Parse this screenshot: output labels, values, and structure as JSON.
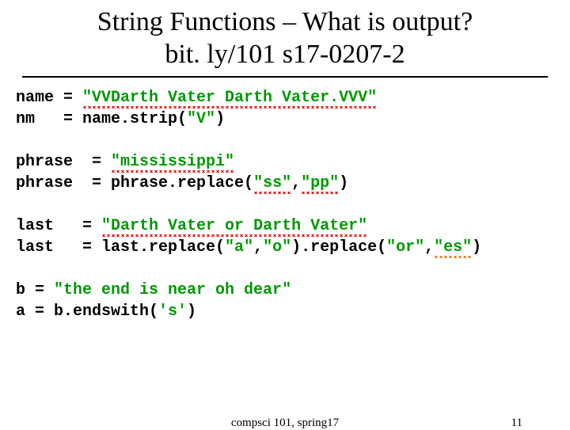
{
  "title": {
    "line1": "String Functions – What is output?",
    "line2": "bit. ly/101 s17-0207-2"
  },
  "code": {
    "l1a": "name = ",
    "l1b": "\"VVDarth Vater Darth Vater.VVV\"",
    "l2a": "nm   = name.strip(",
    "l2b": "\"V\"",
    "l2c": ")",
    "l3a": "phrase  = ",
    "l3b": "\"mississippi\"",
    "l4a": "phrase  = phrase.replace(",
    "l4b": "\"ss\"",
    "l4c": ",",
    "l4d": "\"pp\"",
    "l4e": ")",
    "l5a": "last   = ",
    "l5b": "\"Darth Vater or Darth Vater\"",
    "l6a": "last   = last.replace(",
    "l6b": "\"a\"",
    "l6c": ",",
    "l6d": "\"o\"",
    "l6e": ").replace(",
    "l6f": "\"or\"",
    "l6g": ",",
    "l6h": "\"es\"",
    "l6i": ")",
    "l7a": "b = ",
    "l7b": "\"the end is near oh dear\"",
    "l8a": "a = b.endswith(",
    "l8b": "'s'",
    "l8c": ")"
  },
  "footer": {
    "center": "compsci 101, spring17",
    "page": "11"
  }
}
